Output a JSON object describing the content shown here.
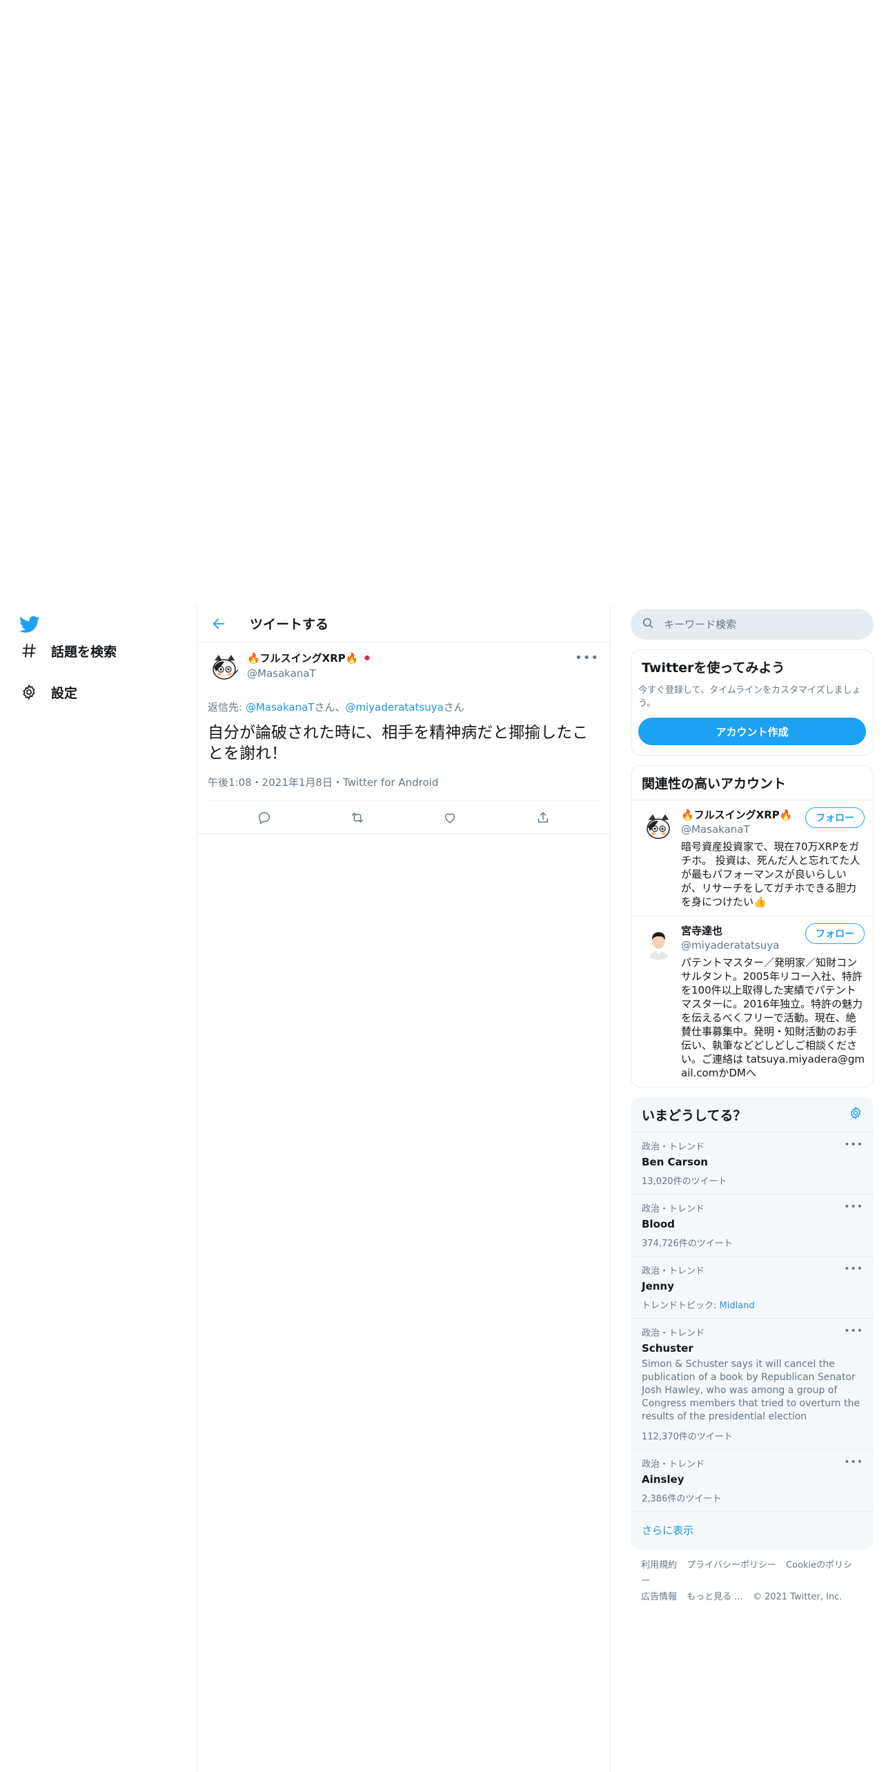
{
  "colors": {
    "brand": "#1da1f2",
    "link": "#1b95e0",
    "secondary_text": "#657786",
    "border": "#e6ecf0"
  },
  "nav": {
    "explore_label": "話題を検索",
    "settings_label": "設定"
  },
  "header": {
    "title": "ツイートする"
  },
  "tweet": {
    "author_name": "🔥フルスイングXRP🔥",
    "author_handle": "@MasakanaT",
    "reply_prefix": "返信先: ",
    "reply_mention_1": "@MasakanaT",
    "reply_san_1": "さん、",
    "reply_mention_2": "@miyaderatatsuya",
    "reply_san_2": "さん",
    "text": "自分が論破された時に、相手を精神病だと揶揄したことを謝れ！",
    "meta": "午後1:08・2021年1月8日・Twitter for Android"
  },
  "search": {
    "placeholder": "キーワード検索"
  },
  "signup": {
    "title": "Twitterを使ってみよう",
    "description": "今すぐ登録して、タイムラインをカスタマイズしましょう。",
    "button": "アカウント作成"
  },
  "related": {
    "title": "関連性の高いアカウント",
    "accounts": [
      {
        "name": "🔥フルスイングXRP🔥",
        "handle": "@MasakanaT",
        "follow": "フォロー",
        "bio": "暗号資産投資家で、現在70万XRPをガチホ。 投資は、死んだ人と忘れてた人が最もパフォーマンスが良いらしいが、リサーチをしてガチホできる胆力を身につけたい👍"
      },
      {
        "name": "宮寺達也",
        "handle": "@miyaderatatsuya",
        "follow": "フォロー",
        "bio": "パテントマスター／発明家／知財コンサルタント。2005年リコー入社、特許を100件以上取得した実績でパテントマスターに。2016年独立。特許の魅力を伝えるべくフリーで活動。現在、絶賛仕事募集中。発明・知財活動のお手伝い、執筆などどしどしご相談ください。ご連絡は tatsuya.miyadera@gmail.comかDMへ"
      }
    ]
  },
  "trends": {
    "title": "いまどうしてる？",
    "items": [
      {
        "context": "政治・トレンド",
        "name": "Ben Carson",
        "desc": "",
        "count": "13,020件のツイート",
        "topic_label": "",
        "topic_link": ""
      },
      {
        "context": "政治・トレンド",
        "name": "Blood",
        "desc": "",
        "count": "374,726件のツイート",
        "topic_label": "",
        "topic_link": ""
      },
      {
        "context": "政治・トレンド",
        "name": "Jenny",
        "desc": "",
        "count": "",
        "topic_label": "トレンドトピック: ",
        "topic_link": "Midland"
      },
      {
        "context": "政治・トレンド",
        "name": "Schuster",
        "desc": "Simon & Schuster says it will cancel the publication of a book by Republican Senator Josh Hawley, who was among a group of Congress members that tried to overturn the results of the presidential election",
        "count": "112,370件のツイート",
        "topic_label": "",
        "topic_link": ""
      },
      {
        "context": "政治・トレンド",
        "name": "Ainsley",
        "desc": "",
        "count": "2,386件のツイート",
        "topic_label": "",
        "topic_link": ""
      }
    ],
    "show_more": "さらに表示"
  },
  "footer": {
    "terms": "利用規約",
    "privacy": "プライバシーポリシー",
    "cookie": "Cookieのポリシー",
    "ads": "広告情報",
    "more": "もっと見る ...",
    "copyright": "© 2021 Twitter, Inc."
  }
}
